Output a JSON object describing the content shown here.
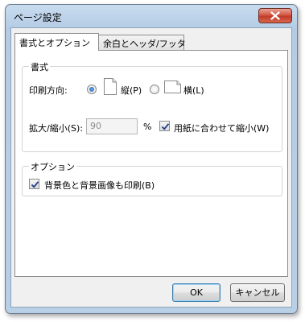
{
  "window": {
    "title": "ページ設定",
    "close_icon": "close-icon"
  },
  "tabs": [
    {
      "label": "書式とオプション",
      "active": true
    },
    {
      "label": "余白とヘッダ/フッタ",
      "active": false
    }
  ],
  "format_group": {
    "title": "書式",
    "orientation_label": "印刷方向:",
    "portrait": {
      "label": "縦(P)",
      "checked": true,
      "icon": "portrait-page-icon"
    },
    "landscape": {
      "label": "横(L)",
      "checked": false,
      "icon": "landscape-page-icon"
    },
    "scale_label": "拡大/縮小(S):",
    "scale_value": "90",
    "scale_unit": "%",
    "shrink_to_fit": {
      "label": "用紙に合わせて縮小(W)",
      "checked": true
    }
  },
  "options_group": {
    "title": "オプション",
    "print_background": {
      "label": "背景色と背景画像も印刷(B)",
      "checked": true
    }
  },
  "buttons": {
    "ok": "OK",
    "cancel": "キャンセル"
  }
}
